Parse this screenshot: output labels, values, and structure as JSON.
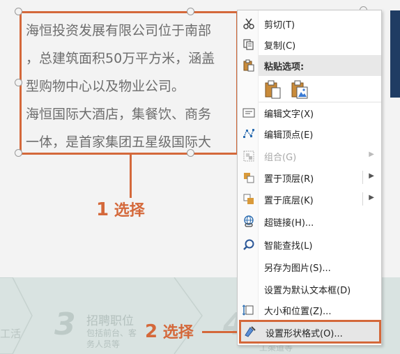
{
  "textbox": {
    "lines": [
      "海恒投资发展有限公司位于南部",
      "，总建筑面积50万平方米，涵盖",
      "型购物中心以及物业公司。",
      "海恒国际大酒店，集餐饮、商务",
      "一体，是首家集团五星级国际大"
    ]
  },
  "callouts": {
    "first": {
      "num": "1",
      "text": "选择"
    },
    "second": {
      "num": "2",
      "text": "选择"
    }
  },
  "steps": {
    "prev_label": "工活",
    "step3_number": "3",
    "step3_title": "招聘职位",
    "step3_desc_line1": "包括前台、客",
    "step3_desc_line2": "务人员等",
    "step4_number": "4",
    "step4_desc": "工渠道等"
  },
  "menu": {
    "cut": {
      "label": "剪切(T)",
      "icon": "scissors-icon"
    },
    "copy": {
      "label": "复制(C)",
      "icon": "copy-icon"
    },
    "paste_options": {
      "label": "粘贴选项:",
      "icon": "paste-icon"
    },
    "edit_text": {
      "label": "编辑文字(X)",
      "icon": "edit-text-icon"
    },
    "edit_points": {
      "label": "编辑顶点(E)",
      "icon": "edit-points-icon"
    },
    "group": {
      "label": "组合(G)",
      "icon": "group-icon"
    },
    "bring_front": {
      "label": "置于顶层(R)",
      "icon": "bring-to-front-icon"
    },
    "send_back": {
      "label": "置于底层(K)",
      "icon": "send-to-back-icon"
    },
    "hyperlink": {
      "label": "超链接(H)...",
      "icon": "hyperlink-icon"
    },
    "smart_lookup": {
      "label": "智能查找(L)",
      "icon": "smart-lookup-icon"
    },
    "save_as_picture": {
      "label": "另存为图片(S)..."
    },
    "set_default_textbox": {
      "label": "设置为默认文本框(D)"
    },
    "size_position": {
      "label": "大小和位置(Z)...",
      "icon": "size-position-icon"
    },
    "format_shape": {
      "label": "设置形状格式(O)...",
      "icon": "format-shape-icon"
    }
  },
  "colors": {
    "accent": "#d4683a",
    "menu_icon": "#3a5a8c",
    "dark_bar": "#1f3c63"
  }
}
